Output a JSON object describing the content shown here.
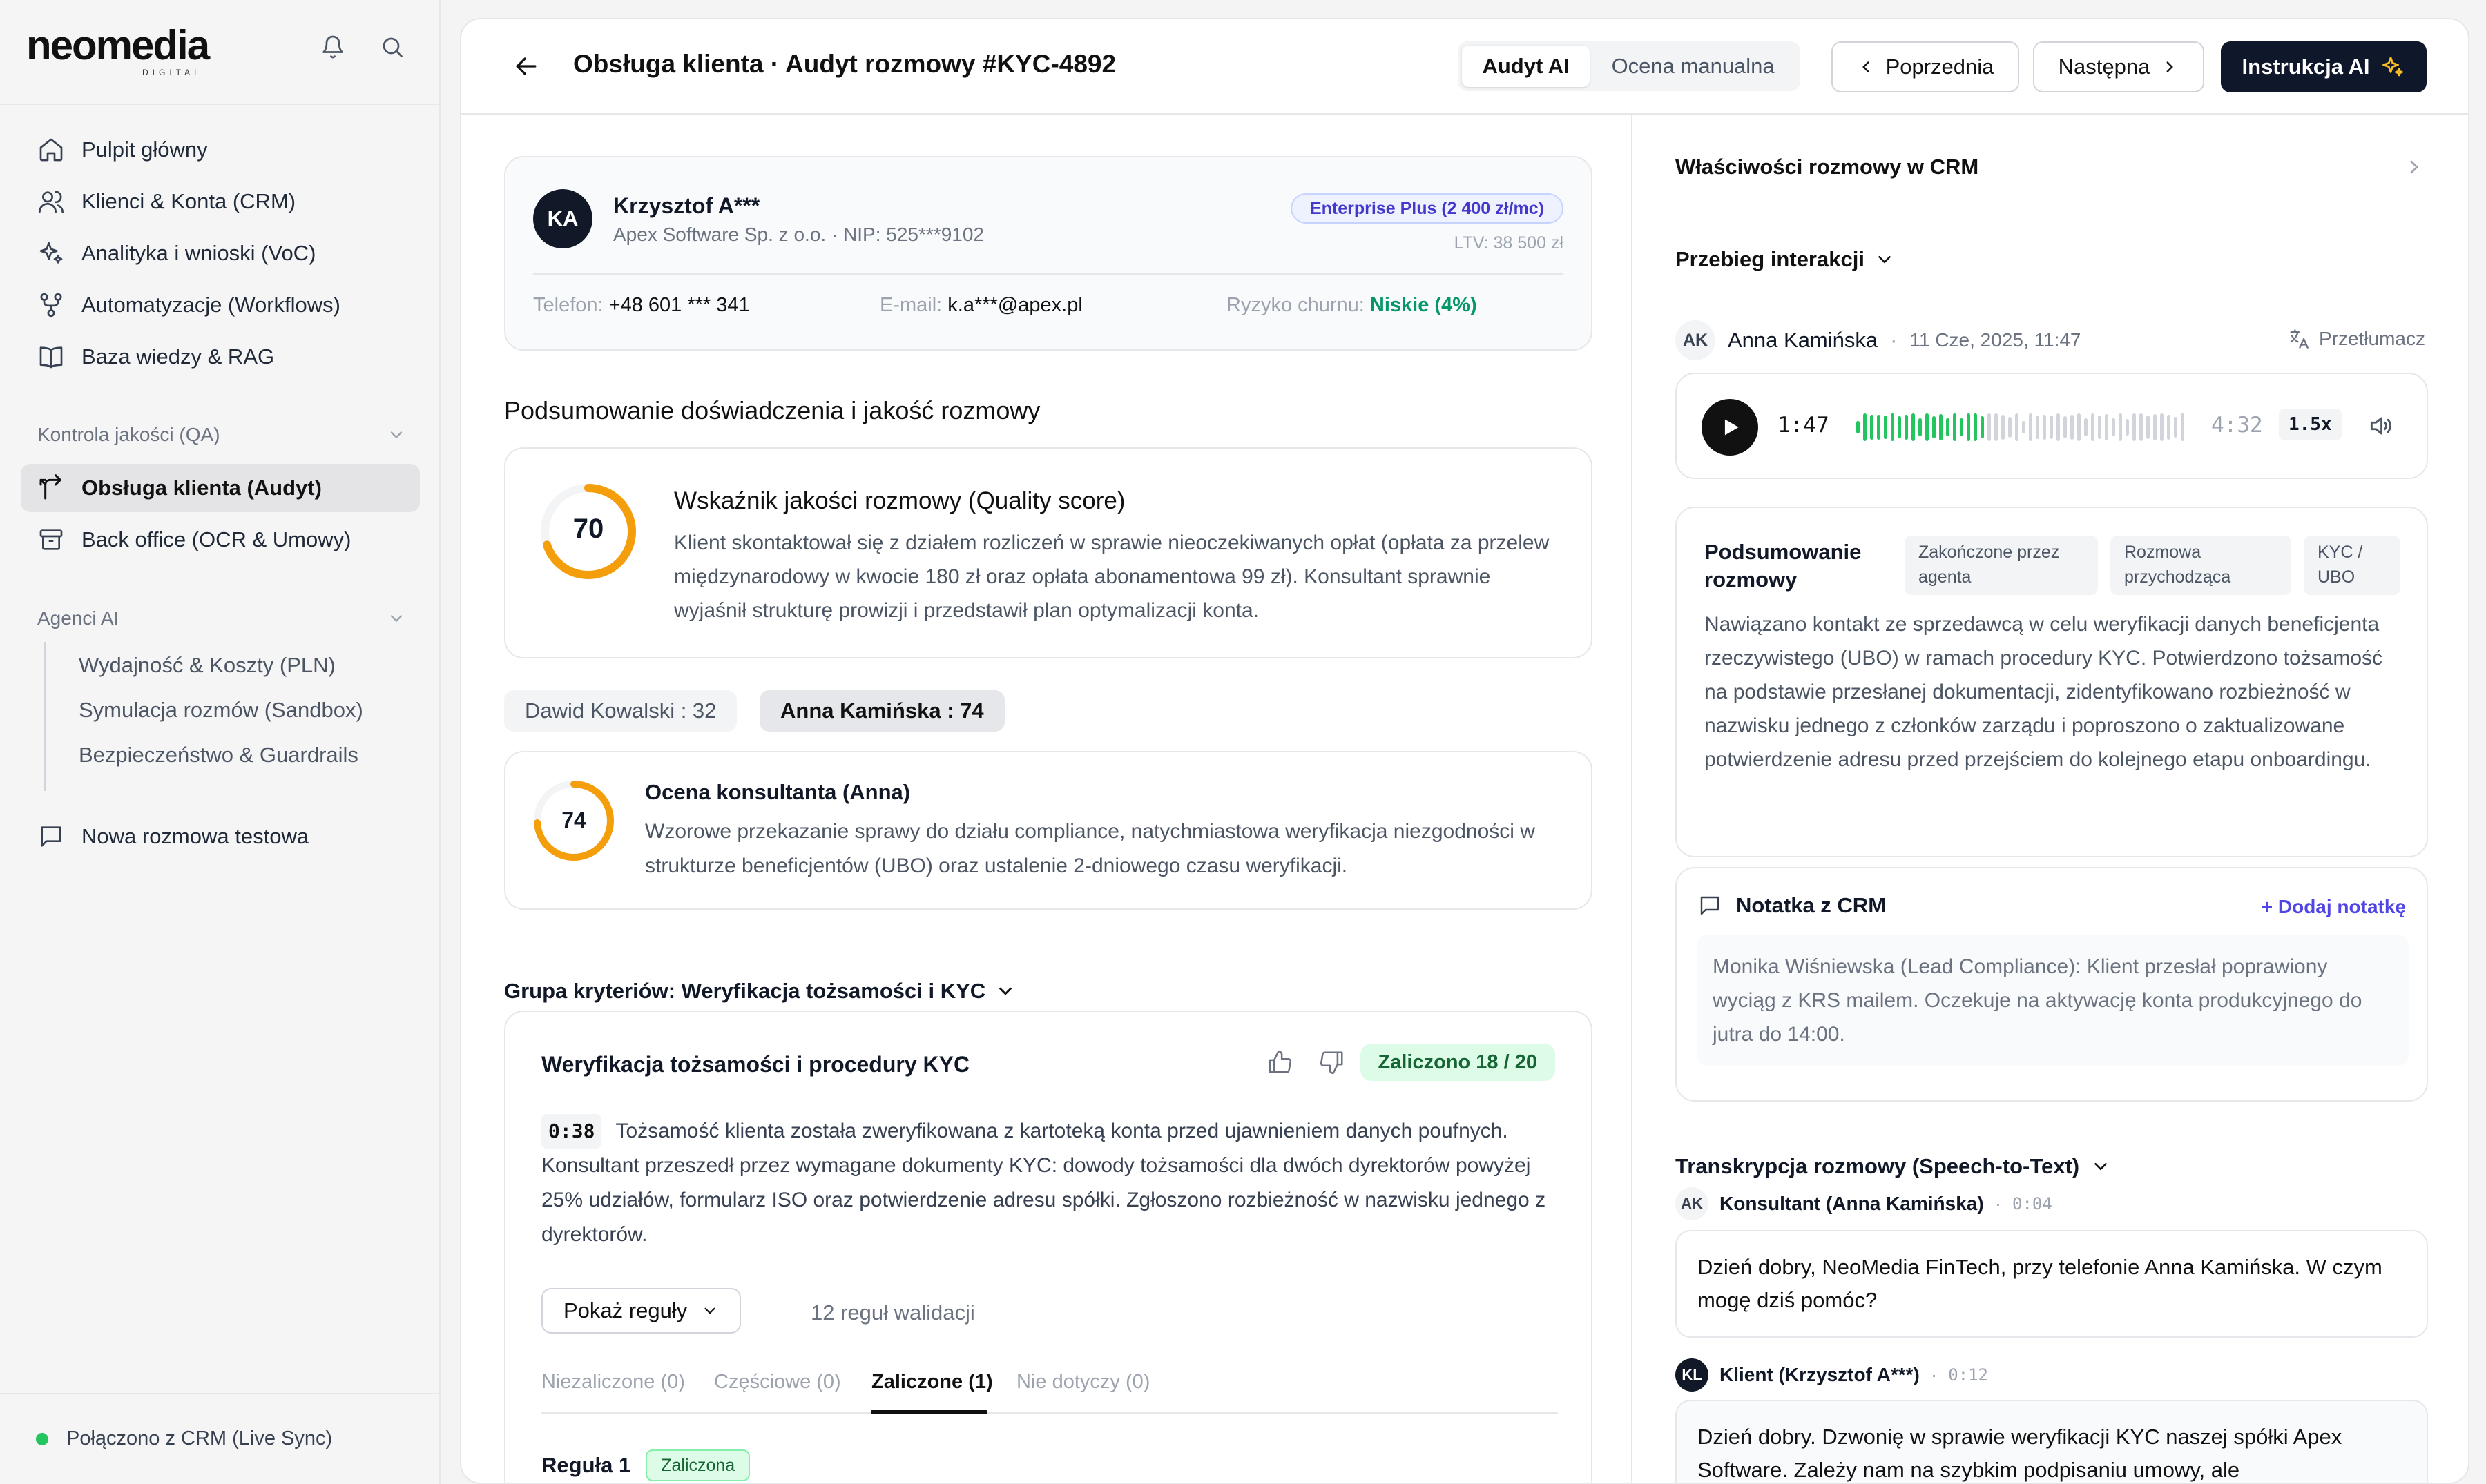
{
  "sidebar": {
    "brand": "neomedia",
    "brand_sub": "DIGITAL",
    "nav": [
      {
        "label": "Pulpit główny",
        "icon": "home-icon"
      },
      {
        "label": "Klienci & Konta (CRM)",
        "icon": "users-icon"
      },
      {
        "label": "Analityka i wnioski (VoC)",
        "icon": "sparkles-icon"
      },
      {
        "label": "Automatyzacje (Workflows)",
        "icon": "workflow-icon"
      },
      {
        "label": "Baza wiedzy & RAG",
        "icon": "book-icon"
      }
    ],
    "qa_label": "Kontrola jakości (QA)",
    "qa_items": [
      {
        "label": "Obsługa klienta (Audyt)",
        "icon": "branch-icon"
      },
      {
        "label": "Back office (OCR & Umowy)",
        "icon": "archive-icon"
      }
    ],
    "agents_label": "Agenci AI",
    "agents_items": [
      "Wydajność & Koszty (PLN)",
      "Symulacja rozmów (Sandbox)",
      "Bezpieczeństwo & Guardrails"
    ],
    "new_chat": "Nowa rozmowa testowa",
    "status": "Połączono z CRM (Live Sync)",
    "status_color": "#22c55e"
  },
  "header": {
    "title": "Obsługa klienta · Audyt rozmowy #KYC-4892",
    "mode_ai": "Audyt AI",
    "mode_manual": "Ocena manualna",
    "prev": "Poprzednia",
    "next": "Następna",
    "instruction": "Instrukcja AI"
  },
  "client": {
    "initials": "KA",
    "name": "Krzysztof A***",
    "company": "Apex Software Sp. z o.o. · NIP: 525***9102",
    "plan": "Enterprise Plus (2 400 zł/mc)",
    "ltv": "LTV: 38 500 zł",
    "phone_label": "Telefon:",
    "phone": "+48 601 *** 341",
    "email_label": "E-mail:",
    "email": "k.a***@apex.pl",
    "churn_label": "Ryzyko churnu:",
    "churn": "Niskie (4%)"
  },
  "summary_section": {
    "heading": "Podsumowanie doświadczenia i jakość rozmowy",
    "quality_score": 70,
    "quality_title": "Wskaźnik jakości rozmowy (Quality score)",
    "quality_text": "Klient skontaktował się z działem rozliczeń w sprawie nieoczekiwanych opłat (opłata za przelew międzynarodowy w kwocie 180 zł oraz opłata abonamentowa 99 zł). Konsultant sprawnie wyjaśnił strukturę prowizji i przedstawił plan optymalizacji konta.",
    "person_tabs": [
      "Dawid Kowalski : 32",
      "Anna Kamińska : 74"
    ],
    "agent_score": 74,
    "agent_title": "Ocena konsultanta (Anna)",
    "agent_text": "Wzorowe przekazanie sprawy do działu compliance, natychmiastowa weryfikacja niezgodności w strukturze beneficjentów (UBO) oraz ustalenie 2-dniowego czasu weryfikacji.",
    "ring_color": "#f59e0b"
  },
  "criteria": {
    "group": "Grupa kryteriów: Weryfikacja tożsamości i KYC",
    "title": "Weryfikacja tożsamości i procedury KYC",
    "badge": "Zaliczono 18 / 20",
    "timecode": "0:38",
    "text": "Tożsamość klienta została zweryfikowana z kartoteką konta przed ujawnieniem danych poufnych. Konsultant przeszedł przez wymagane dokumenty KYC: dowody tożsamości dla dwóch dyrektorów powyżej 25% udziałów, formularz ISO oraz potwierdzenie adresu spółki. Zgłoszono rozbieżność w nazwisku jednego z dyrektorów.",
    "rules_btn": "Pokaż reguły",
    "rules_count": "12 reguł walidacji",
    "tabs": [
      "Niezaliczone (0)",
      "Częściowe (0)",
      "Zaliczone (1)",
      "Nie dotyczy (0)"
    ],
    "rule_label": "Reguła 1",
    "rule_status": "Zaliczona"
  },
  "right": {
    "crm_props": "Właściwości rozmowy w CRM",
    "flow": "Przebieg interakcji",
    "speaker_initials": "AK",
    "speaker": "Anna Kamińska",
    "date": "11 Cze, 2025, 11:47",
    "translator": "Przetłumacz",
    "time_current": "1:47",
    "time_total": "4:32",
    "speed": "1.5x",
    "summary_title": "Podsumowanie rozmowy",
    "tags": [
      "Zakończone przez agenta",
      "Rozmowa przychodząca",
      "KYC / UBO"
    ],
    "summary_text": "Nawiązano kontakt ze sprzedawcą w celu weryfikacji danych beneficjenta rzeczywistego (UBO) w ramach procedury KYC. Potwierdzono tożsamość na podstawie przesłanej dokumentacji, zidentyfikowano rozbieżność w nazwisku jednego z członków zarządu i poproszono o zaktualizowane potwierdzenie adresu przed przejściem do kolejnego etapu onboardingu.",
    "note_title": "Notatka z CRM",
    "add_note": "+ Dodaj notatkę",
    "note_text": "Monika Wiśniewska (Lead Compliance): Klient przesłał poprawiony wyciąg z KRS mailem. Oczekuje na aktywację konta produkcyjnego do jutra do 14:00.",
    "transcript_title": "Transkrypcja rozmowy (Speech-to-Text)",
    "messages": [
      {
        "initials": "AK",
        "who": "Konsultant (Anna Kamińska)",
        "time": "0:04",
        "text": "Dzień dobry, NeoMedia FinTech, przy telefonie Anna Kamińska. W czym mogę dziś pomóc?"
      },
      {
        "initials": "KL",
        "who": "Klient (Krzysztof A***)",
        "time": "0:12",
        "text": "Dzień dobry. Dzwonię w sprawie weryfikacji KYC naszej spółki Apex Software. Zależy nam na szybkim podpisaniu umowy, ale"
      }
    ]
  }
}
